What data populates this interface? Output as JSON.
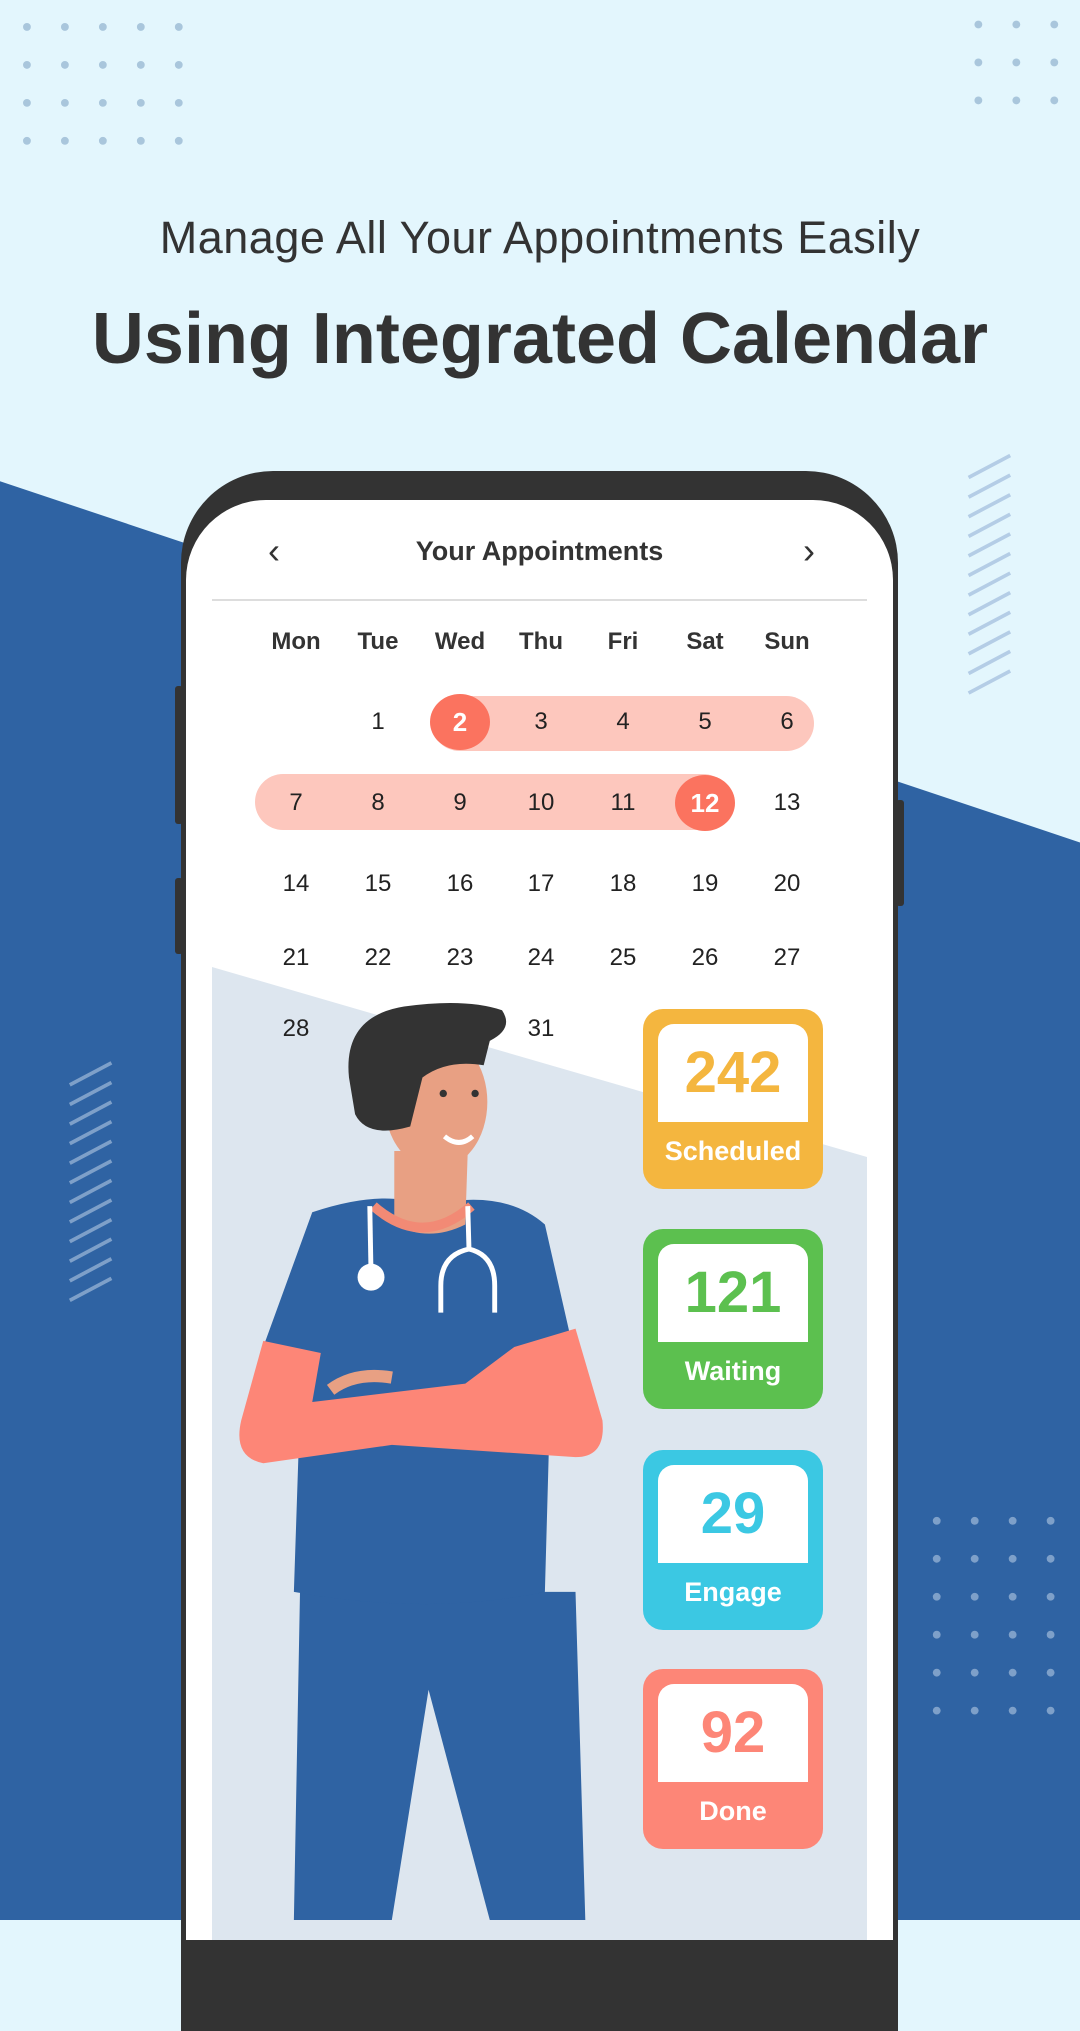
{
  "headline": {
    "subtitle": "Manage All Your Appointments Easily",
    "title": "Using Integrated Calendar"
  },
  "calendar": {
    "title": "Your Appointments",
    "prev_icon": "chevron-left-icon",
    "next_icon": "chevron-right-icon",
    "weekdays": [
      "Mon",
      "Tue",
      "Wed",
      "Thu",
      "Fri",
      "Sat",
      "Sun"
    ],
    "days": [
      "1",
      "2",
      "3",
      "4",
      "5",
      "6",
      "7",
      "8",
      "9",
      "10",
      "11",
      "12",
      "13",
      "14",
      "15",
      "16",
      "17",
      "18",
      "19",
      "20",
      "21",
      "22",
      "23",
      "24",
      "25",
      "26",
      "27",
      "28",
      "31"
    ],
    "range_start": "2",
    "range_end": "12"
  },
  "stats": [
    {
      "value": "242",
      "label": "Scheduled",
      "color": "#f4b63f"
    },
    {
      "value": "121",
      "label": "Waiting",
      "color": "#5cc04f"
    },
    {
      "value": "29",
      "label": "Engage",
      "color": "#3bc8e3"
    },
    {
      "value": "92",
      "label": "Done",
      "color": "#fd8677"
    }
  ],
  "colors": {
    "background": "#e3f6fd",
    "blue": "#2f63a3",
    "accent": "#fb735f",
    "range": "#fdc7bd"
  }
}
